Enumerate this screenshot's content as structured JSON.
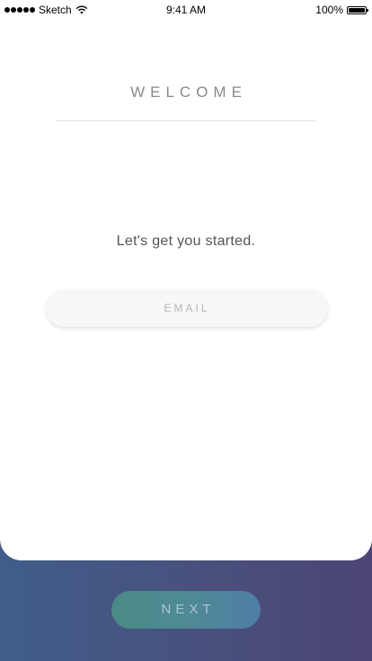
{
  "status_bar": {
    "carrier": "Sketch",
    "time": "9:41 AM",
    "battery": "100%",
    "signal_icon": "signal-dots-icon",
    "wifi_icon": "wifi-icon",
    "battery_icon": "battery-icon"
  },
  "header": {
    "title": "WELCOME"
  },
  "main": {
    "tagline": "Let's get you started.",
    "email_placeholder": "EMAIL",
    "email_value": ""
  },
  "footer": {
    "next_label": "NEXT"
  },
  "colors": {
    "background_gradient_start": "#3f5d89",
    "background_gradient_end": "#4b4575",
    "button_gradient_start": "#4a8a86",
    "button_gradient_end": "#4f7ea6",
    "title_color": "#8a8a8a"
  }
}
